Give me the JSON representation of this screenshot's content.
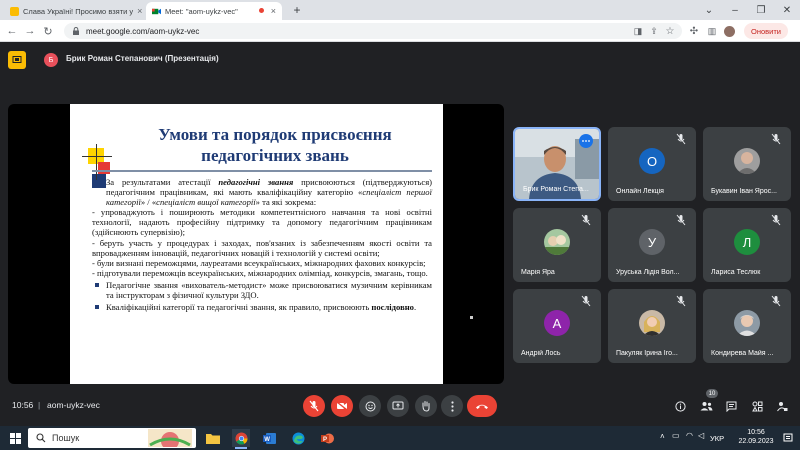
{
  "browser": {
    "tabs": [
      {
        "title": "Слава Україні! Просимо взяти у"
      },
      {
        "title": "Meet: \"aom-uykz-vec\""
      }
    ],
    "url": "meet.google.com/aom-uykz-vec",
    "update_label": "Оновити"
  },
  "meet": {
    "presenter_initial": "Б",
    "presenter_label": "Брик Роман Степанович (Презентація)",
    "clock": "10:56",
    "separator": "|",
    "meeting_code": "aom-uykz-vec",
    "participant_count": "10"
  },
  "slide": {
    "title_line1": "Умови та порядок присвоєння",
    "title_line2": "педагогічних звань",
    "p1_a": "За результатами атестації ",
    "p1_b": "педагогічні звання",
    "p1_c": " присвоюються (підтверджуються) педагогічним працівникам, які мають кваліфікаційну категорію «",
    "p1_d": "спеціаліст першої категорії",
    "p1_e": "» / «",
    "p1_f": "спеціаліст вищої категорії",
    "p1_g": "» та які зокрема:",
    "d1": "- упроваджують і поширюють методики компетентнісного навчання та нові освітні технології, надають професійну підтримку та допомогу педагогічним працівникам (здійснюють супервізію);",
    "d2": "- беруть участь у процедурах і заходах, пов'язаних із забезпеченням якості освіти та впровадженням інновацій, педагогічних новацій і технологій у системі освіти;",
    "d3": "- були визнані переможцями, лауреатами всеукраїнських, міжнародних фахових конкурсів;",
    "d4": "- підготували переможців всеукраїнських, міжнародних олімпіад, конкурсів, змагань, тощо.",
    "p2": "Педагогічне звання «вихователь-методист» може присвоюватися музичним керівникам та інструкторам з фізичної культури ЗДО.",
    "p3_a": "Кваліфікаційні категорії та педагогічні звання, як правило, присвоюють ",
    "p3_b": "послідовно",
    "p3_c": "."
  },
  "participants": [
    {
      "name": "Брик Роман Степа...",
      "type": "video",
      "muted": false
    },
    {
      "name": "Онлайн Лекція",
      "type": "initial",
      "initial": "О",
      "color": "#1565c0",
      "muted": true
    },
    {
      "name": "Букавин Іван Ярос...",
      "type": "photo",
      "muted": true
    },
    {
      "name": "Марія Яра",
      "type": "photo",
      "muted": true
    },
    {
      "name": "Уруська Лідія Вол...",
      "type": "initial",
      "initial": "У",
      "color": "#5f6368",
      "muted": true
    },
    {
      "name": "Лариса Теслюк",
      "type": "initial",
      "initial": "Л",
      "color": "#1e8e3e",
      "muted": true
    },
    {
      "name": "Андрій Лось",
      "type": "initial",
      "initial": "А",
      "color": "#8e24aa",
      "muted": true
    },
    {
      "name": "Пакуляк Ірина Іго...",
      "type": "photo",
      "muted": true
    },
    {
      "name": "Кондирева Майя ...",
      "type": "photo",
      "muted": true
    }
  ],
  "taskbar": {
    "search_placeholder": "Пошук",
    "lang": "УКР",
    "time": "10:56",
    "date": "22.09.2023"
  },
  "colors": {
    "meet_bg": "#202124",
    "accent_red": "#ea4335",
    "slide_title": "#1f3b75",
    "active_tile_border": "#8ab4f8"
  }
}
